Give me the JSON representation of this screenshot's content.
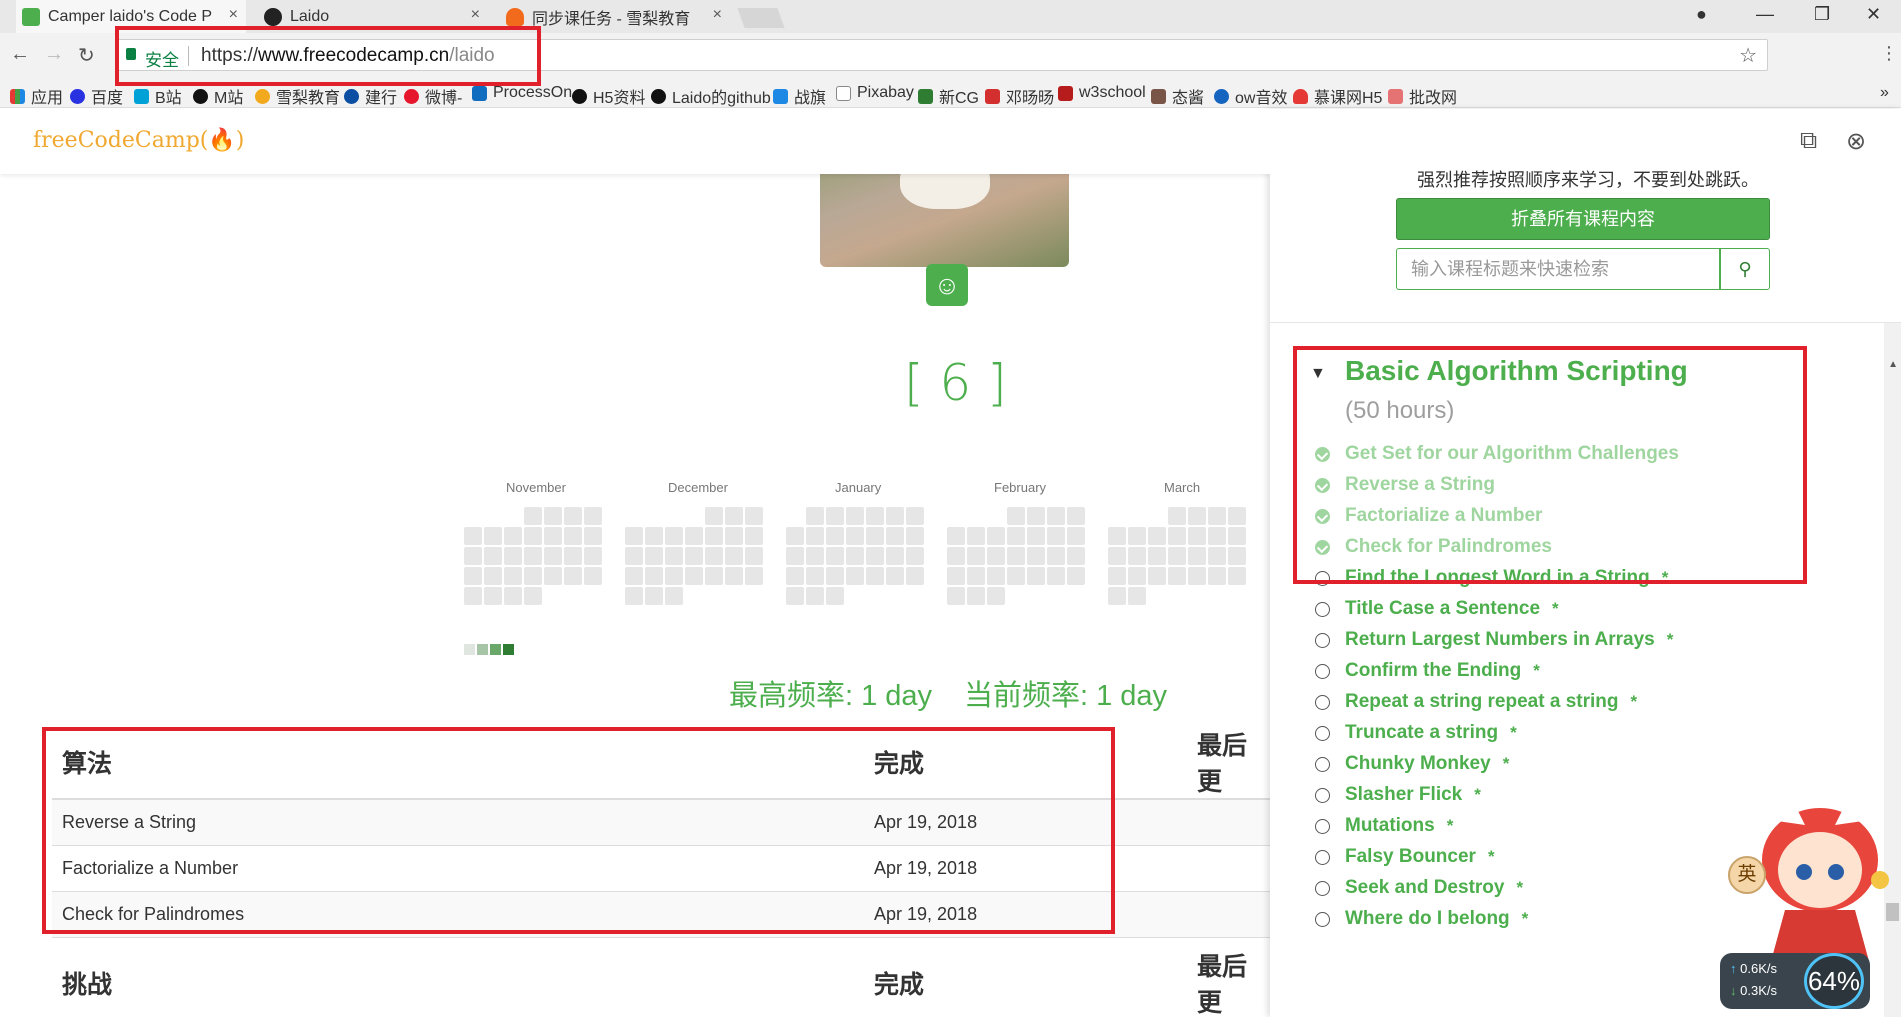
{
  "browser": {
    "tabs": [
      {
        "title": "Camper laido's Code P",
        "close": "×"
      },
      {
        "title": "Laido",
        "close": "×"
      },
      {
        "title": "同步课任务 - 雪梨教育",
        "close": "×"
      }
    ],
    "omnibox": {
      "secure_label": "安全",
      "url_scheme": "https://",
      "url_host": "www.freecodecamp.cn",
      "url_path": "/laido"
    },
    "bookmarks": [
      "应用",
      "百度",
      "B站",
      "M站",
      "雪梨教育",
      "建行",
      "微博-",
      "ProcessOn",
      "H5资料",
      "Laido的github",
      "战旗",
      "Pixabay",
      "新CG",
      "邓旸旸",
      "w3school",
      "态酱",
      "ow音效",
      "慕课网H5",
      "批改网"
    ],
    "colors": {
      "accent_green": "#4cae4c",
      "highlight_red": "#e0202a"
    }
  },
  "profile": {
    "logo_main": "freeCodeCamp",
    "logo_flame": "(🔥)",
    "points": "[ 6 ]",
    "months": [
      "November",
      "December",
      "January",
      "February",
      "March"
    ],
    "longest_streak": "最高频率: 1 day",
    "current_streak": "当前频率: 1 day"
  },
  "algorithms_table": {
    "headers": [
      "算法",
      "完成",
      "最后更"
    ],
    "rows": [
      {
        "name": "Reverse a String",
        "completed": "Apr 19, 2018"
      },
      {
        "name": "Factorialize a Number",
        "completed": "Apr 19, 2018"
      },
      {
        "name": "Check for Palindromes",
        "completed": "Apr 19, 2018"
      }
    ]
  },
  "challenges_table": {
    "headers": [
      "挑战",
      "完成",
      "最后更"
    ]
  },
  "map_panel": {
    "notice": "强烈推荐按照顺序来学习，不要到处跳跃。",
    "collapse_button": "折叠所有课程内容",
    "search_placeholder": "输入课程标题来快速检索",
    "block_title": "Basic Algorithm Scripting",
    "block_hours": "(50 hours)",
    "challenges": [
      {
        "title": "Get Set for our Algorithm Challenges",
        "done": true,
        "star": ""
      },
      {
        "title": "Reverse a String",
        "done": true,
        "star": ""
      },
      {
        "title": "Factorialize a Number",
        "done": true,
        "star": ""
      },
      {
        "title": "Check for Palindromes",
        "done": true,
        "star": ""
      },
      {
        "title": "Find the Longest Word in a String",
        "done": false,
        "star": "*"
      },
      {
        "title": "Title Case a Sentence",
        "done": false,
        "star": "*"
      },
      {
        "title": "Return Largest Numbers in Arrays",
        "done": false,
        "star": "*"
      },
      {
        "title": "Confirm the Ending",
        "done": false,
        "star": "*"
      },
      {
        "title": "Repeat a string repeat a string",
        "done": false,
        "star": "*"
      },
      {
        "title": "Truncate a string",
        "done": false,
        "star": "*"
      },
      {
        "title": "Chunky Monkey",
        "done": false,
        "star": "*"
      },
      {
        "title": "Slasher Flick",
        "done": false,
        "star": "*"
      },
      {
        "title": "Mutations",
        "done": false,
        "star": "*"
      },
      {
        "title": "Falsy Bouncer",
        "done": false,
        "star": "*"
      },
      {
        "title": "Seek and Destroy",
        "done": false,
        "star": "*"
      },
      {
        "title": "Where do I belong",
        "done": false,
        "star": "*"
      }
    ]
  },
  "overlays": {
    "ime_label": "英",
    "upload_speed": "0.6K/s",
    "download_speed": "0.3K/s",
    "cpu_percent": "64%"
  }
}
